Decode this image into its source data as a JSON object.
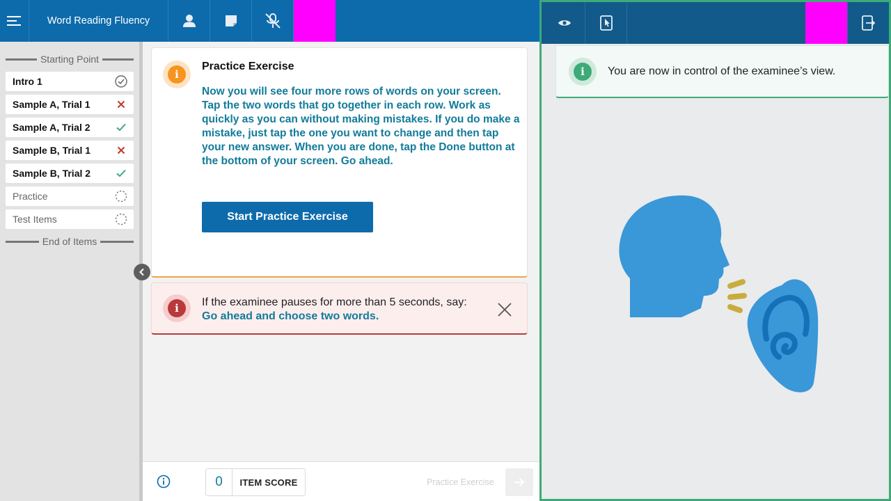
{
  "header": {
    "app_title": "Word Reading Fluency"
  },
  "sidebar": {
    "top_divider": "Starting Point",
    "bottom_divider": "End of Items",
    "items": [
      {
        "label": "Intro 1",
        "status": "complete"
      },
      {
        "label": "Sample A, Trial 1",
        "status": "incorrect"
      },
      {
        "label": "Sample A, Trial 2",
        "status": "correct"
      },
      {
        "label": "Sample B, Trial 1",
        "status": "incorrect"
      },
      {
        "label": "Sample B, Trial 2",
        "status": "correct"
      },
      {
        "label": "Practice",
        "status": "pending"
      },
      {
        "label": "Test Items",
        "status": "pending"
      }
    ]
  },
  "main": {
    "exercise_title": "Practice Exercise",
    "instructions": "Now you will see four more rows of words on your screen. Tap the two words that go together in each row. Work as quickly as you can without making mistakes. If you do make a mistake, just tap the one you want to change and then tap your new answer. When you are done, tap the Done button at the bottom of your screen. Go ahead.",
    "start_button": "Start Practice Exercise",
    "alert_text": "If the examinee pauses for more than 5 seconds, say:",
    "alert_prompt": "Go ahead and choose two words."
  },
  "footer": {
    "item_score_value": "0",
    "item_score_label": "ITEM SCORE",
    "next_label": "Practice Exercise"
  },
  "examinee": {
    "control_message": "You are now in control of the examinee’s view."
  },
  "colors": {
    "primary_blue": "#0d6bac",
    "teal_text": "#127b9a",
    "orange": "#f7941d",
    "red": "#b83a3a",
    "green": "#3daa78",
    "magenta": "#ff00ff"
  },
  "icons": {
    "menu": "hamburger-menu-icon",
    "person": "person-icon",
    "note": "note-icon",
    "mic_off": "microphone-off-icon",
    "eye": "eye-icon",
    "tablet_touch": "tablet-touch-icon",
    "exit": "exit-tablet-icon"
  }
}
